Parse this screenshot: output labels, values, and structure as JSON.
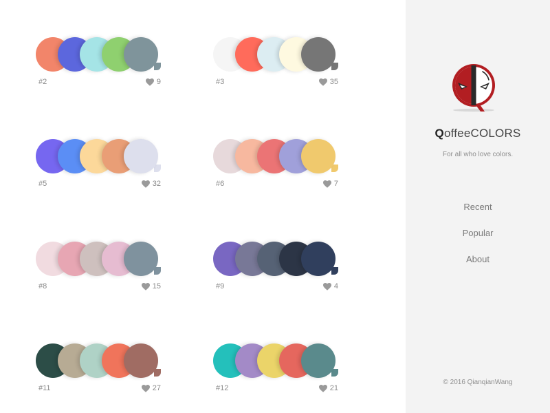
{
  "palettes": [
    {
      "id": "#2",
      "likes": "9",
      "colors": [
        "#F2856A",
        "#5C67DD",
        "#A5E4E6",
        "#8FD06F",
        "#7F949B"
      ]
    },
    {
      "id": "#3",
      "likes": "35",
      "colors": [
        "#F5F5F5",
        "#FF6B5B",
        "#DCEDF2",
        "#FEF9E0",
        "#767676"
      ]
    },
    {
      "id": "#5",
      "likes": "32",
      "colors": [
        "#7667F0",
        "#5B8EF5",
        "#FCD89A",
        "#E99E76",
        "#DDDFED"
      ]
    },
    {
      "id": "#6",
      "likes": "7",
      "colors": [
        "#E7D9DB",
        "#F7B89F",
        "#EB7475",
        "#A0A0DA",
        "#F0C96D"
      ]
    },
    {
      "id": "#8",
      "likes": "15",
      "colors": [
        "#F1DBE0",
        "#E7A6B3",
        "#CEC0BE",
        "#E6BCD1",
        "#7F929E"
      ]
    },
    {
      "id": "#9",
      "likes": "4",
      "colors": [
        "#7967C2",
        "#787897",
        "#566275",
        "#2C3546",
        "#303F5D"
      ]
    },
    {
      "id": "#11",
      "likes": "27",
      "colors": [
        "#2C4D47",
        "#B7AB94",
        "#AFD2C6",
        "#F0745B",
        "#A06C63"
      ]
    },
    {
      "id": "#12",
      "likes": "21",
      "colors": [
        "#24C0BB",
        "#A38AC7",
        "#EBD469",
        "#E5675E",
        "#5A8A8C"
      ]
    }
  ],
  "sidebar": {
    "brand_q": "Q",
    "brand_rest": "offeeCOLORS",
    "tagline": "For all who love colors.",
    "nav": [
      "Recent",
      "Popular",
      "About"
    ],
    "footer": "© 2016 QianqianWang"
  },
  "colors": {
    "sidebar_bg": "#F3F3F3",
    "logo_red": "#B21E22",
    "logo_dark": "#2A2A2A"
  },
  "icons": {
    "like": "heart-icon",
    "logo": "deadpool-mask-icon"
  }
}
